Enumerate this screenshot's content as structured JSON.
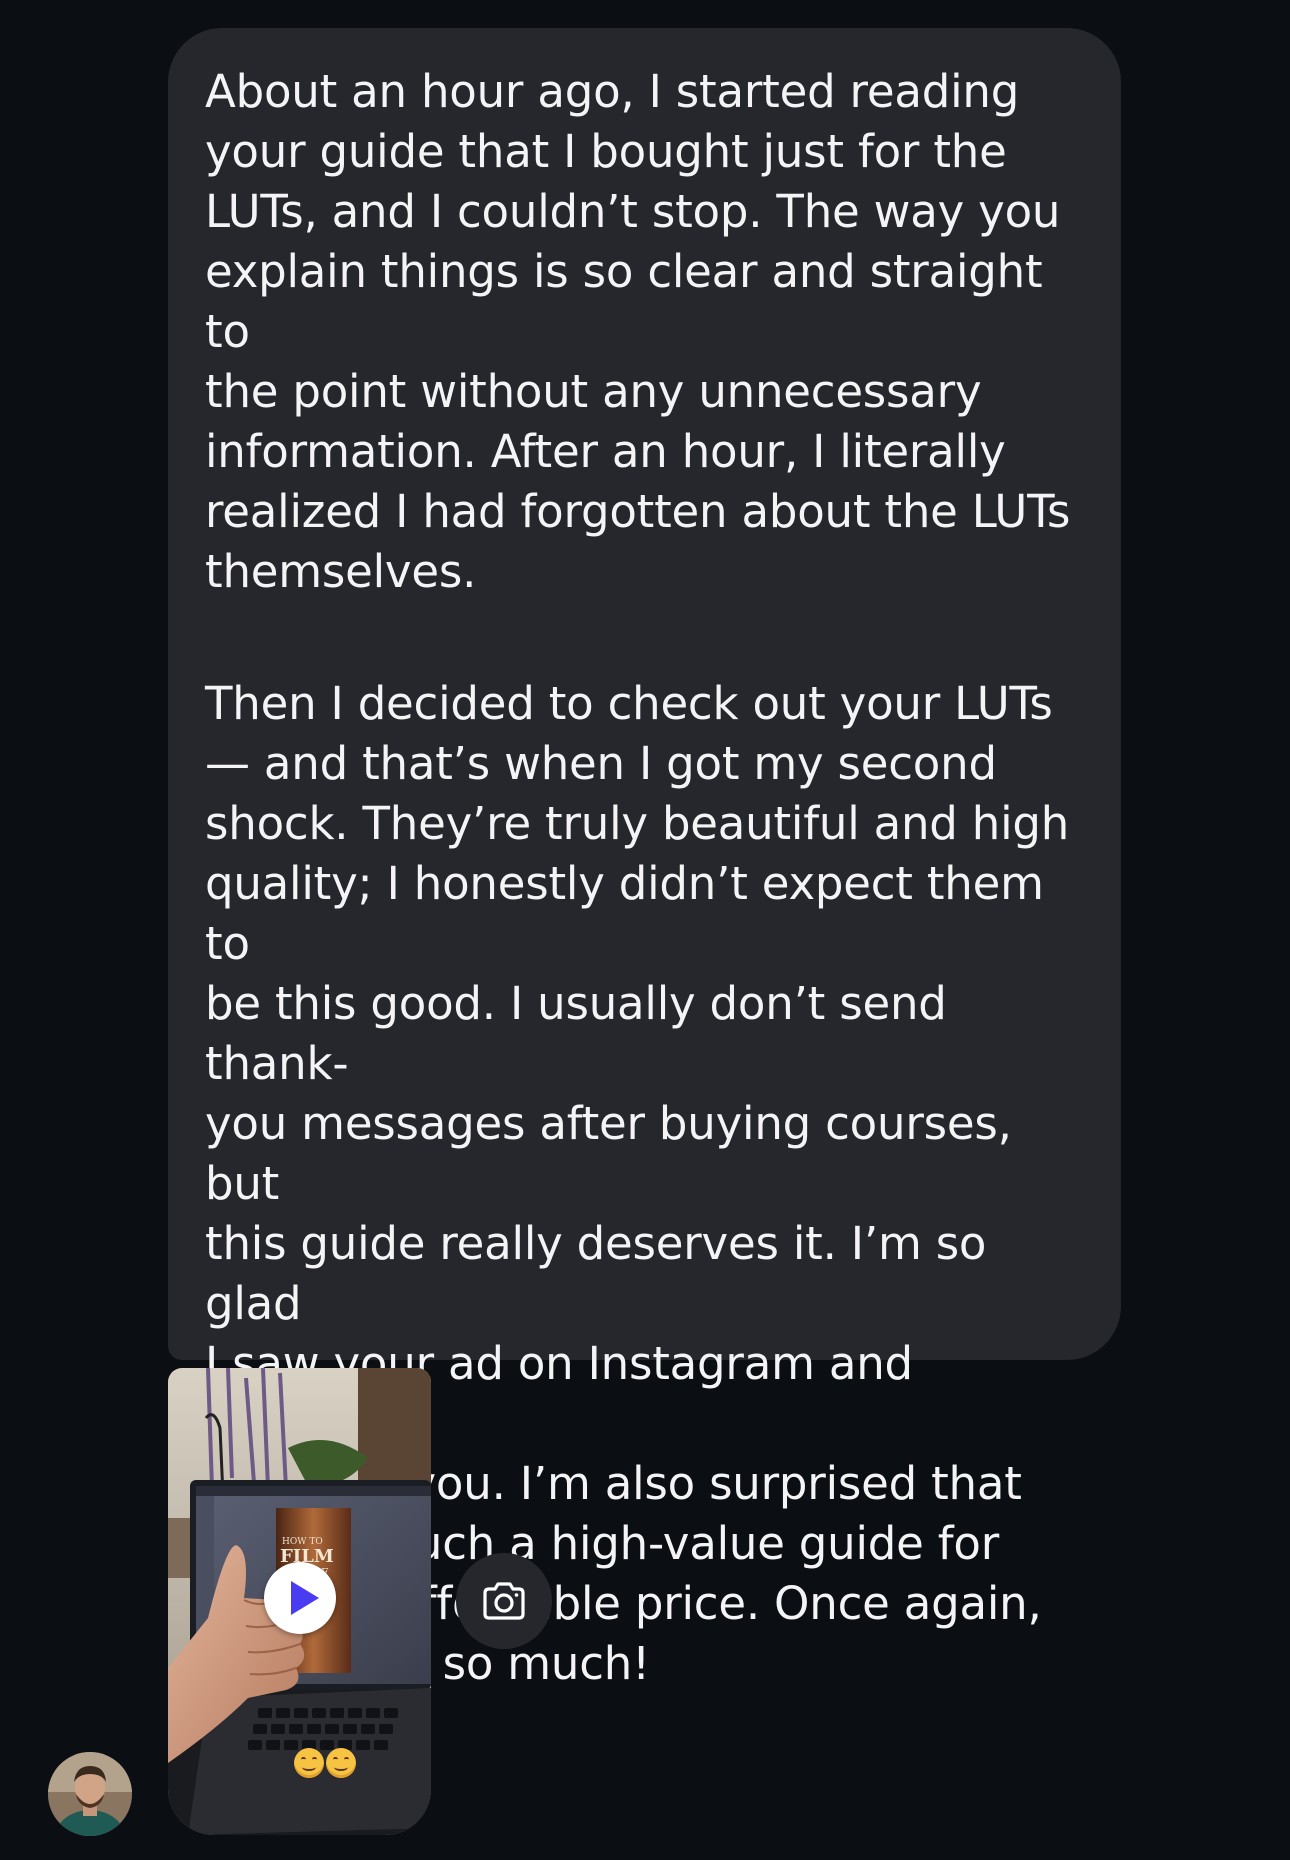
{
  "message": {
    "paragraphs": [
      "About an hour ago, I started reading\nyour guide that I bought just for the\nLUTs, and I couldn’t stop. The way you\nexplain things is so clear and straight to\nthe point without any unnecessary\ninformation. After an hour, I literally\nrealized I had forgotten about the LUTs\nthemselves.",
      "Then I decided to check out your LUTs\n— and that’s when I got my second\nshock. They’re truly beautiful and high\nquality; I honestly didn’t expect them to\nbe this good. I usually don’t send thank-\nyou messages after buying courses, but\nthis guide really deserves it. I’m so glad\nI saw your ad on Instagram and decided\nto follow you. I’m also surprised that\nyou sell such a high-value guide for\nsuch an affordable price. Once again,\nthank you so much!"
    ]
  },
  "video": {
    "play_icon": "play-icon",
    "reactions": [
      "😊",
      "😊"
    ],
    "screen_text": "HOW TO FILM YOURSELF GUIDE"
  },
  "camera_icon": "camera-icon",
  "avatar_icon": "avatar",
  "colors": {
    "background": "#0b0e13",
    "bubble": "#25272d",
    "text": "#f4f4f6",
    "play_accent": "#4a3cf0"
  }
}
